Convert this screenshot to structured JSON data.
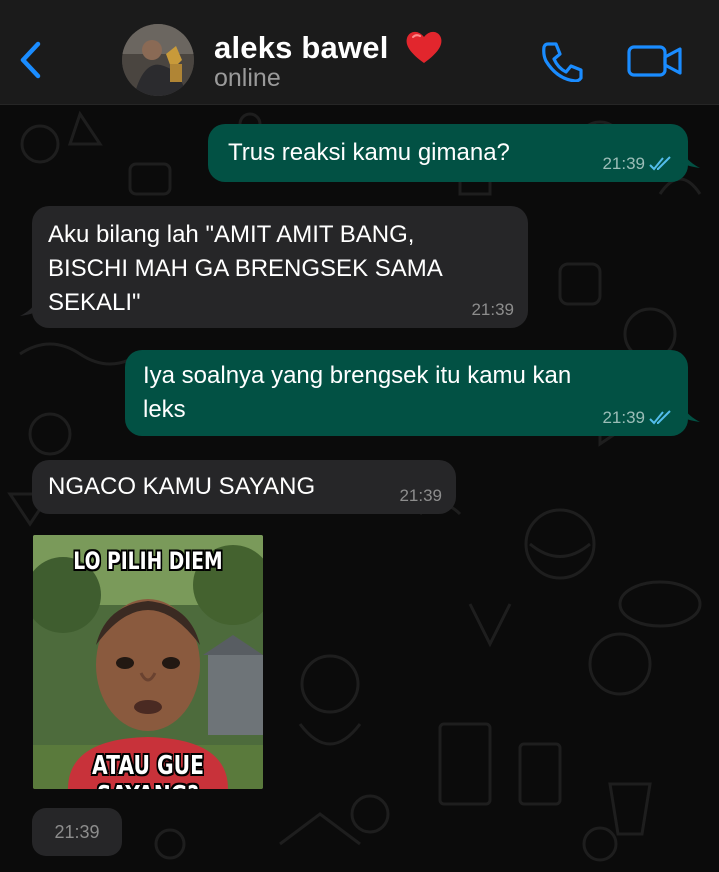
{
  "header": {
    "back_icon": "chevron-left-icon",
    "contact_name": "aleks bawel",
    "name_emoji": "red-heart",
    "status": "online",
    "call_icon": "phone-icon",
    "video_icon": "video-camera-icon",
    "accent_color": "#1a8cff"
  },
  "messages": [
    {
      "direction": "out",
      "text": "Trus reaksi kamu gimana?",
      "time": "21:39",
      "read": true
    },
    {
      "direction": "in",
      "text": "Aku bilang lah \"AMIT AMIT BANG, BISCHI MAH GA BRENGSEK SAMA SEKALI\"",
      "lines": [
        "Aku bilang lah \"AMIT AMIT BANG,",
        "BISCHI MAH GA BRENGSEK SAMA",
        "SEKALI\""
      ],
      "time": "21:39"
    },
    {
      "direction": "out",
      "text": "Iya soalnya yang brengsek itu kamu kan leks",
      "lines": [
        "Iya soalnya yang brengsek itu kamu kan",
        "leks"
      ],
      "time": "21:39",
      "read": true
    },
    {
      "direction": "in",
      "text": "NGACO KAMU SAYANG",
      "time": "21:39"
    },
    {
      "direction": "in",
      "type": "image",
      "caption_top": "LO PILIH DIEM",
      "caption_bottom": "ATAU GUE SAYANG?"
    },
    {
      "direction": "in",
      "time_only": "21:39"
    }
  ],
  "colors": {
    "outgoing_bubble": "#025144",
    "incoming_bubble": "#262628",
    "read_ticks": "#53bdeb"
  }
}
